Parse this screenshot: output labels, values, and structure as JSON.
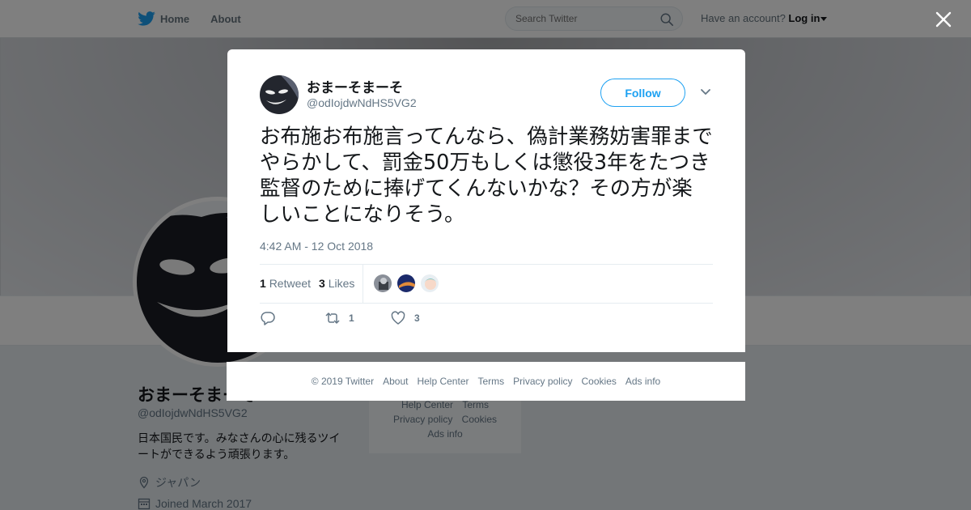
{
  "topbar": {
    "home_label": "Home",
    "about_label": "About",
    "search_placeholder": "Search Twitter",
    "account_prompt": "Have an account?",
    "login_label": "Log in"
  },
  "profile": {
    "name": "おまーそまーそ",
    "handle": "@odIojdwNdHS5VG2",
    "bio": "日本国民です。みなさんの心に残るツイートができるよう頑張ります。",
    "location": "ジャパン",
    "joined": "Joined March 2017"
  },
  "side_footer": {
    "row1": [
      "Help Center",
      "Terms"
    ],
    "row2": [
      "Privacy policy",
      "Cookies"
    ],
    "row3": [
      "Ads info"
    ]
  },
  "tweet": {
    "author_name": "おまーそまーそ",
    "author_handle": "@odIojdwNdHS5VG2",
    "follow_label": "Follow",
    "text": "お布施お布施言ってんなら、偽計業務妨害罪までやらかして、罰金50万もしくは懲役3年をたつき監督のために捧げてくんないかな？その方が楽しいことになりそう。",
    "timestamp": "4:42 AM - 12 Oct 2018",
    "retweet_count": "1",
    "retweet_label": "Retweet",
    "like_count": "3",
    "like_label": "Likes",
    "actions": {
      "reply_count": "",
      "retweet_count": "1",
      "like_count": "3"
    }
  },
  "modal_footer": [
    "© 2019 Twitter",
    "About",
    "Help Center",
    "Terms",
    "Privacy policy",
    "Cookies",
    "Ads info"
  ],
  "colors": {
    "brand_blue": "#1da1f2",
    "text_dark": "#14171a",
    "text_muted": "#657786"
  },
  "icons": {
    "logo": "twitter-bird-icon",
    "search": "search-icon",
    "close": "close-icon",
    "menu": "chevron-down-icon",
    "reply": "reply-icon",
    "retweet": "retweet-icon",
    "like": "heart-icon",
    "location": "location-pin-icon",
    "calendar": "calendar-icon"
  }
}
